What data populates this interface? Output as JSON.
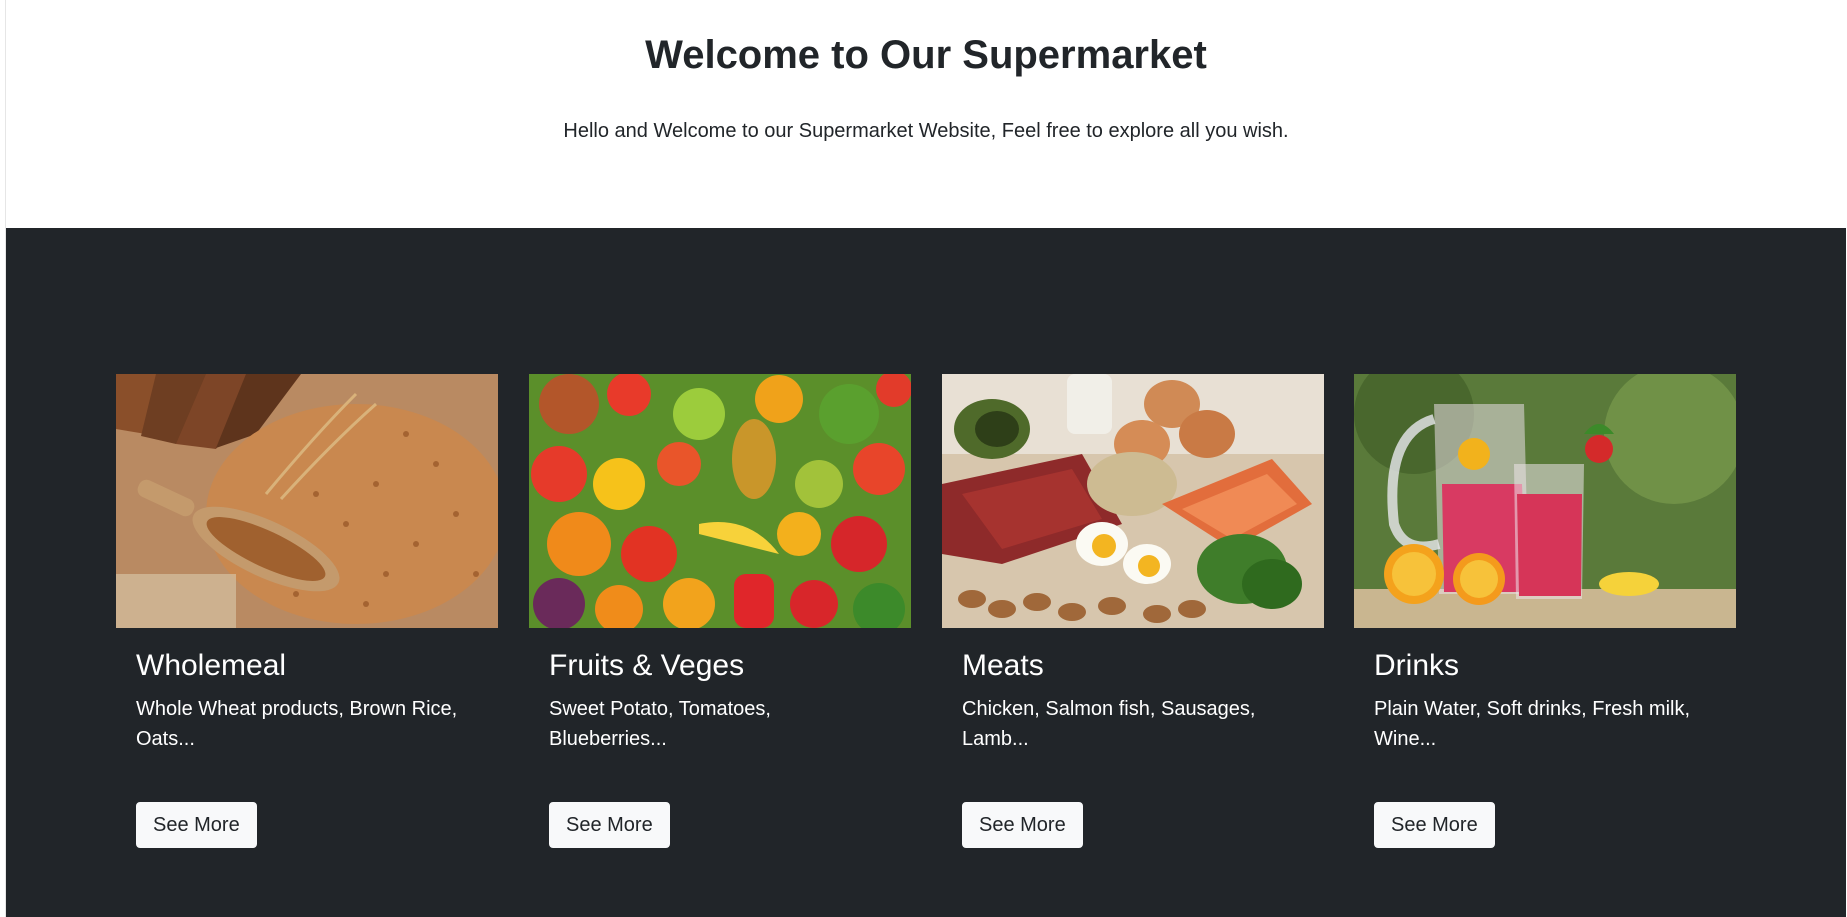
{
  "hero": {
    "title": "Welcome to Our Supermarket",
    "subtitle": "Hello and Welcome to our Supermarket Website, Feel free to explore all you wish."
  },
  "cards": [
    {
      "title": "Wholemeal",
      "description": "Whole Wheat products, Brown Rice, Oats...",
      "button": "See More",
      "image": "wheat-grains-bread-photo"
    },
    {
      "title": "Fruits & Veges",
      "description": "Sweet Potato, Tomatoes, Blueberries...",
      "button": "See More",
      "image": "fruits-vegetables-photo"
    },
    {
      "title": "Meats",
      "description": "Chicken, Salmon fish, Sausages, Lamb...",
      "button": "See More",
      "image": "meat-eggs-salmon-photo"
    },
    {
      "title": "Drinks",
      "description": "Plain Water, Soft drinks, Fresh milk, Wine...",
      "button": "See More",
      "image": "pitcher-drinks-photo"
    }
  ],
  "colors": {
    "dark_section": "#212529",
    "button_bg": "#f8f9fa"
  }
}
